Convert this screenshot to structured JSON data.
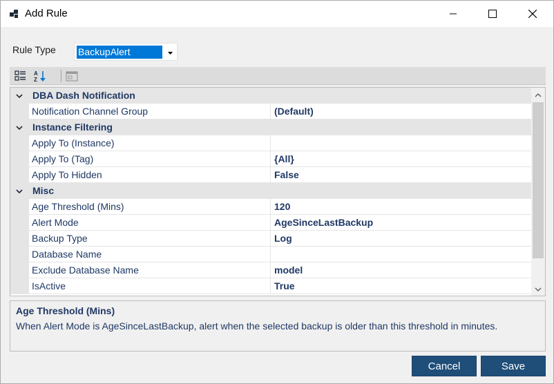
{
  "window": {
    "title": "Add Rule",
    "icons": {
      "app": "app-icon",
      "minimize": "minimize-icon",
      "maximize": "maximize-icon",
      "close": "close-icon"
    }
  },
  "rule_type": {
    "label": "Rule Type",
    "value": "BackupAlert"
  },
  "toolbar": {
    "buttons": [
      "categorized-view-icon",
      "alphabetical-sort-icon",
      "property-pages-icon"
    ]
  },
  "property_grid": {
    "categories": [
      {
        "label": "DBA Dash Notification",
        "properties": [
          {
            "name": "Notification Channel Group",
            "value": "(Default)"
          }
        ]
      },
      {
        "label": "Instance Filtering",
        "properties": [
          {
            "name": "Apply To (Instance)",
            "value": ""
          },
          {
            "name": "Apply To (Tag)",
            "value": "{All}"
          },
          {
            "name": "Apply To Hidden",
            "value": "False"
          }
        ]
      },
      {
        "label": "Misc",
        "properties": [
          {
            "name": "Age Threshold (Mins)",
            "value": "120"
          },
          {
            "name": "Alert Mode",
            "value": "AgeSinceLastBackup"
          },
          {
            "name": "Backup Type",
            "value": "Log"
          },
          {
            "name": "Database Name",
            "value": ""
          },
          {
            "name": "Exclude Database Name",
            "value": "model"
          },
          {
            "name": "IsActive",
            "value": "True"
          }
        ]
      }
    ],
    "scrollbar_position": 0.0
  },
  "description": {
    "title": "Age Threshold (Mins)",
    "text": "When Alert Mode is AgeSinceLastBackup, alert when the selected backup is older than this threshold in minutes."
  },
  "buttons": {
    "cancel": "Cancel",
    "save": "Save"
  },
  "colors": {
    "accent": "#1f4e79",
    "selection": "#0078d7",
    "category_bg": "#e5e5e5",
    "text_blue": "#1f3864"
  }
}
